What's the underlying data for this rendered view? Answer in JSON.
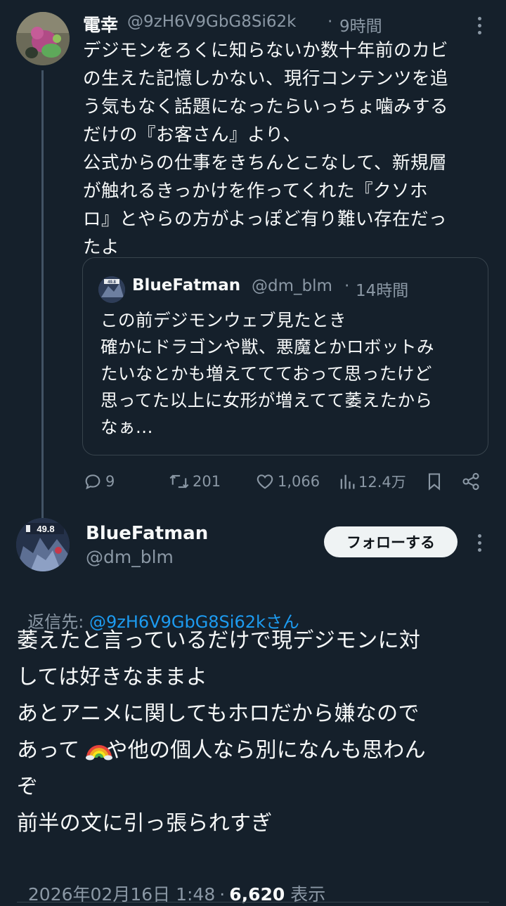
{
  "tweet1": {
    "name": "電幸",
    "handle": "@9zH6V9GbG8Si62k",
    "sep": "·",
    "time": "9時間",
    "text": "デジモンをろくに知らないか数十年前のカビ\nの生えた記憶しかない、現行コンテンツを追\nう気もなく話題になったらいっちょ噛みする\nだけの『お客さん』より、\n公式からの仕事をきちんとこなして、新規層\nが触れるきっかけを作ってくれた『クソホ\nロ』とやらの方がよっぽど有り難い存在だっ\nたよ",
    "quote": {
      "avatar_badge": "49.8",
      "name": "BlueFatman",
      "handle": "@dm_blm",
      "sep": "·",
      "time": "14時間",
      "text": "この前デジモンウェブ見たとき\n確かにドラゴンや獣、悪魔とかロボットみ\nたいなとかも増えててておって思ったけど\n思ってた以上に女形が増えてて萎えたから\nなぁ..."
    },
    "actions": {
      "replies": "9",
      "retweets": "201",
      "likes": "1,066",
      "views": "12.4万"
    }
  },
  "tweet2": {
    "avatar_badge": "49.8",
    "name": "BlueFatman",
    "handle": "@dm_blm",
    "follow_label": "フォローする",
    "reply_to_prefix": "返信先: ",
    "reply_to_handle": "@9zH6V9GbG8Si62kさん",
    "text_lines": [
      "萎えたと言っているだけで現デジモンに対",
      "しては好きなままよ",
      "あとアニメに関してもホロだから嫌なので",
      "や他の個人なら別になんも思わん",
      "ぞ",
      "前半の文に引っ張られすぎ"
    ],
    "line4_prefix": "あって",
    "rainbow_emoji": "🌈",
    "timestamp": "2026年02月16日 1:48",
    "sep": "·",
    "views_count": "6,620",
    "views_label": "表示"
  },
  "colors": {
    "background": "#15202b",
    "link": "#1d9bf0",
    "muted": "#8b98a5",
    "border": "#38444d"
  }
}
